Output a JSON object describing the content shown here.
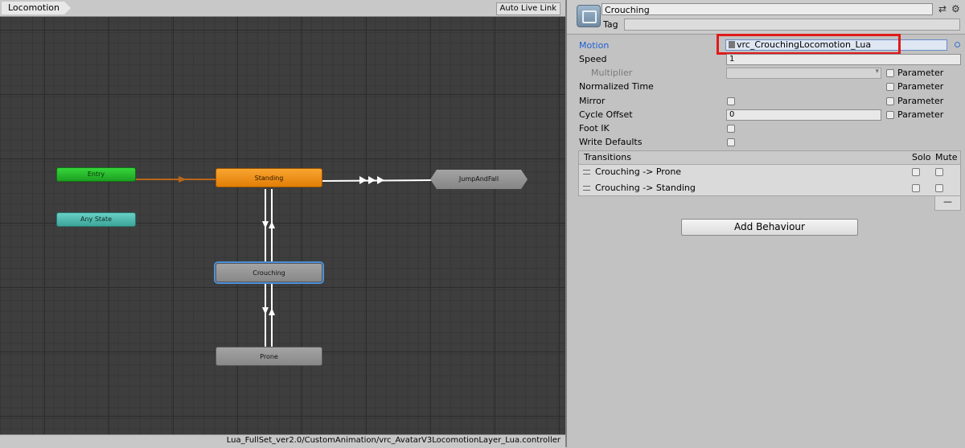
{
  "graph": {
    "layer_tab": "Locomotion",
    "auto_live_link": "Auto Live Link",
    "asset_path": "Lua_FullSet_ver2.0/CustomAnimation/vrc_AvatarV3LocomotionLayer_Lua.controller",
    "nodes": {
      "entry": "Entry",
      "any_state": "Any State",
      "standing": "Standing",
      "jump_and_fall": "JumpAndFall",
      "crouching": "Crouching",
      "prone": "Prone"
    },
    "colors": {
      "entry": "#2cc130",
      "any_state": "#5bc4b8",
      "default_state": "#f09419",
      "state": "#959595",
      "selection": "#4d8fd8"
    }
  },
  "inspector": {
    "state_name": "Crouching",
    "tag_label": "Tag",
    "tag_value": "",
    "motion_label": "Motion",
    "motion_value": "vrc_CrouchingLocomotion_Lua",
    "speed_label": "Speed",
    "speed_value": "1",
    "multiplier_label": "Multiplier",
    "normalized_time_label": "Normalized Time",
    "mirror_label": "Mirror",
    "cycle_offset_label": "Cycle Offset",
    "cycle_offset_value": "0",
    "foot_ik_label": "Foot IK",
    "write_defaults_label": "Write Defaults",
    "parameter_label": "Parameter",
    "transitions_header": "Transitions",
    "solo_label": "Solo",
    "mute_label": "Mute",
    "transitions": [
      "Crouching -> Prone",
      "Crouching -> Standing"
    ],
    "remove_label": "—",
    "add_behaviour_label": "Add Behaviour",
    "highlight_color": "#e01a1a"
  }
}
